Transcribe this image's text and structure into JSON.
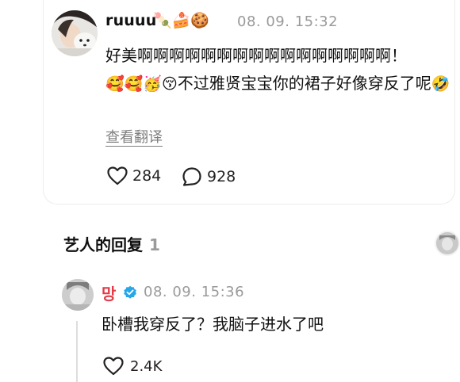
{
  "comment": {
    "username": "ruuuu",
    "badges": "🍡🍰🍪",
    "timestamp": "08. 09. 15:32",
    "text_main": "好美啊啊啊啊啊啊啊啊啊啊啊啊啊啊啊啊！",
    "emojis": "🥰🥰🥳😚",
    "text_rest": "不过雅贤宝宝你的裙子好像穿反了呢",
    "trailing_emoji": "🤣",
    "translate_label": "查看翻译",
    "like_count": "284",
    "reply_count": "928"
  },
  "artist_replies": {
    "heading": "艺人的回复",
    "count": "1"
  },
  "reply": {
    "username": "망",
    "timestamp": "08. 09. 15:36",
    "text": "卧槽我穿反了？我脑子进水了吧",
    "like_count": "2.4K"
  },
  "colors": {
    "reply_name": "#e23c48",
    "verified": "#27a7e8",
    "muted": "#9a9a9a"
  }
}
